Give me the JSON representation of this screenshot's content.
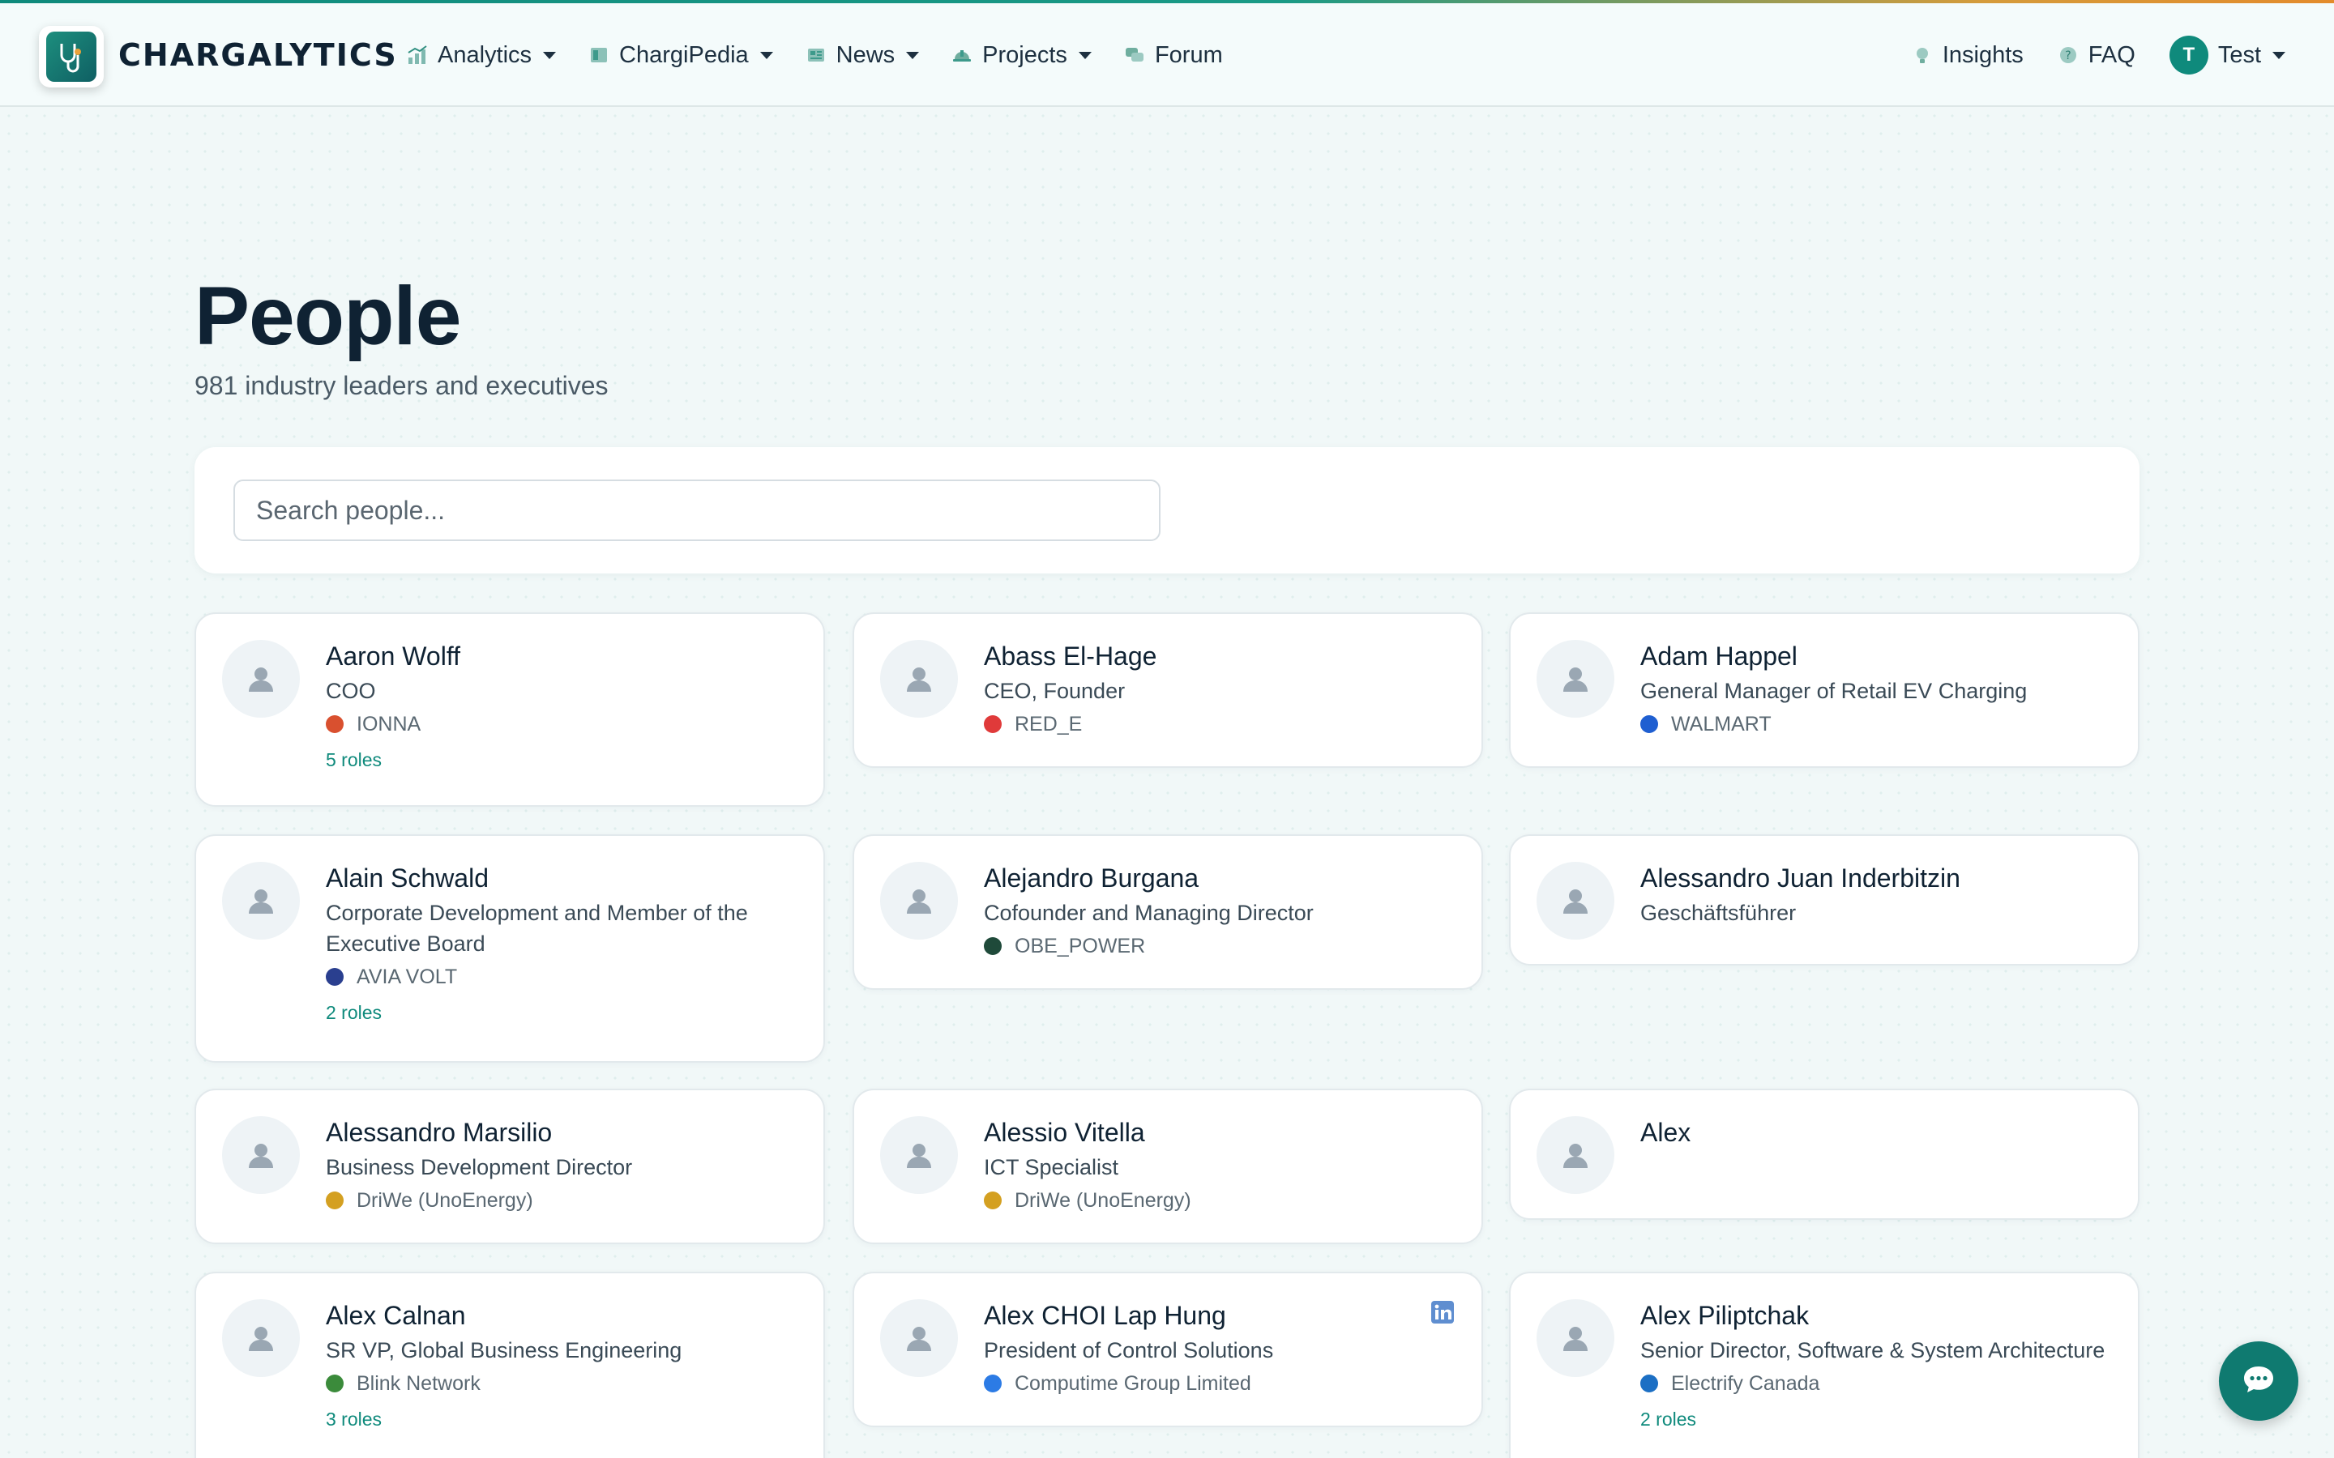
{
  "brand": {
    "name": "CHARGALYTICS"
  },
  "nav": {
    "left": [
      {
        "label": "Analytics",
        "icon": "analytics-icon",
        "dropdown": true
      },
      {
        "label": "ChargiPedia",
        "icon": "book-icon",
        "dropdown": true
      },
      {
        "label": "News",
        "icon": "newspaper-icon",
        "dropdown": true
      },
      {
        "label": "Projects",
        "icon": "hardhat-icon",
        "dropdown": true
      },
      {
        "label": "Forum",
        "icon": "chat-bubbles-icon",
        "dropdown": false
      }
    ],
    "right": [
      {
        "label": "Insights",
        "icon": "lightbulb-icon"
      },
      {
        "label": "FAQ",
        "icon": "question-icon"
      }
    ],
    "user": {
      "initial": "T",
      "name": "Test"
    }
  },
  "page": {
    "title": "People",
    "subtitle": "981 industry leaders and executives"
  },
  "search": {
    "placeholder": "Search people...",
    "value": ""
  },
  "people": [
    {
      "name": "Aaron Wolff",
      "title": "COO",
      "company": "IONNA",
      "company_color": "#d9502f",
      "roles": "5 roles"
    },
    {
      "name": "Abass El-Hage",
      "title": "CEO, Founder",
      "company": "RED_E",
      "company_color": "#e03a3a",
      "roles": ""
    },
    {
      "name": "Adam Happel",
      "title": "General Manager of Retail EV Charging",
      "company": "WALMART",
      "company_color": "#1f5fd1",
      "roles": ""
    },
    {
      "name": "Alain Schwald",
      "title": "Corporate Development and Member of the Executive Board",
      "company": "AVIA VOLT",
      "company_color": "#2a3f8f",
      "roles": "2 roles"
    },
    {
      "name": "Alejandro Burgana",
      "title": "Cofounder and Managing Director",
      "company": "OBE_POWER",
      "company_color": "#1f4a3a",
      "roles": ""
    },
    {
      "name": "Alessandro Juan Inderbitzin",
      "title": "Geschäftsführer",
      "company": "",
      "company_color": "",
      "roles": ""
    },
    {
      "name": "Alessandro Marsilio",
      "title": "Business Development Director",
      "company": "DriWe (UnoEnergy)",
      "company_color": "#d4a021",
      "roles": ""
    },
    {
      "name": "Alessio Vitella",
      "title": "ICT Specialist",
      "company": "DriWe (UnoEnergy)",
      "company_color": "#d4a021",
      "roles": ""
    },
    {
      "name": "Alex",
      "title": "",
      "company": "",
      "company_color": "",
      "roles": ""
    },
    {
      "name": "Alex Calnan",
      "title": "SR VP, Global Business Engineering",
      "company": "Blink Network",
      "company_color": "#3b8b3b",
      "roles": "3 roles"
    },
    {
      "name": "Alex CHOI Lap Hung",
      "title": "President of Control Solutions",
      "company": "Computime Group Limited",
      "company_color": "#2c7be5",
      "roles": "",
      "linkedin": true
    },
    {
      "name": "Alex Piliptchak",
      "title": "Senior Director, Software & System Architecture",
      "company": "Electrify Canada",
      "company_color": "#1c6fc4",
      "roles": "2 roles"
    }
  ],
  "colors": {
    "accent": "#0f8a7c",
    "text": "#0f2233",
    "muted": "#5a6872"
  }
}
